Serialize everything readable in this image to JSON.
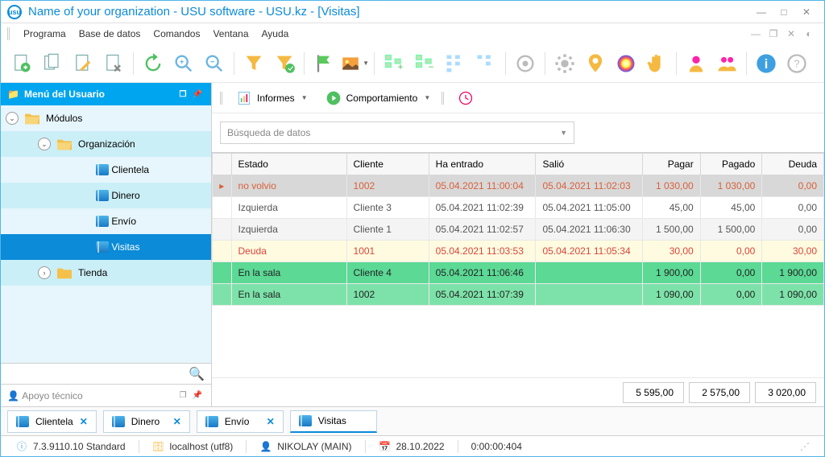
{
  "window": {
    "title": "Name of your organization - USU software - USU.kz - [Visitas]"
  },
  "menu": {
    "items": [
      "Programa",
      "Base de datos",
      "Comandos",
      "Ventana",
      "Ayuda"
    ]
  },
  "sidebar": {
    "title": "Menú del Usuario",
    "tree": {
      "modules": "Módulos",
      "organization": "Organización",
      "clientela": "Clientela",
      "dinero": "Dinero",
      "envio": "Envío",
      "visitas": "Visitas",
      "tienda": "Tienda"
    },
    "support": "Apoyo técnico"
  },
  "toolbar2": {
    "informes": "Informes",
    "comportamiento": "Comportamiento"
  },
  "search": {
    "placeholder": "Búsqueda de datos"
  },
  "grid": {
    "headers": {
      "estado": "Estado",
      "cliente": "Cliente",
      "entrado": "Ha entrado",
      "salio": "Salió",
      "pagar": "Pagar",
      "pagado": "Pagado",
      "deuda": "Deuda"
    },
    "rows": [
      {
        "estado": "no volvio",
        "cliente": "1002",
        "entrado": "05.04.2021 11:00:04",
        "salio": "05.04.2021 11:02:03",
        "pagar": "1 030,00",
        "pagado": "1 030,00",
        "deuda": "0,00"
      },
      {
        "estado": "Izquierda",
        "cliente": "Cliente 3",
        "entrado": "05.04.2021 11:02:39",
        "salio": "05.04.2021 11:05:00",
        "pagar": "45,00",
        "pagado": "45,00",
        "deuda": "0,00"
      },
      {
        "estado": "Izquierda",
        "cliente": "Cliente 1",
        "entrado": "05.04.2021 11:02:57",
        "salio": "05.04.2021 11:06:30",
        "pagar": "1 500,00",
        "pagado": "1 500,00",
        "deuda": "0,00"
      },
      {
        "estado": "Deuda",
        "cliente": "1001",
        "entrado": "05.04.2021 11:03:53",
        "salio": "05.04.2021 11:05:34",
        "pagar": "30,00",
        "pagado": "0,00",
        "deuda": "30,00"
      },
      {
        "estado": "En la sala",
        "cliente": "Cliente 4",
        "entrado": "05.04.2021 11:06:46",
        "salio": "",
        "pagar": "1 900,00",
        "pagado": "0,00",
        "deuda": "1 900,00"
      },
      {
        "estado": "En la sala",
        "cliente": "1002",
        "entrado": "05.04.2021 11:07:39",
        "salio": "",
        "pagar": "1 090,00",
        "pagado": "0,00",
        "deuda": "1 090,00"
      }
    ],
    "totals": {
      "pagar": "5 595,00",
      "pagado": "2 575,00",
      "deuda": "3 020,00"
    }
  },
  "tabs": [
    {
      "label": "Clientela"
    },
    {
      "label": "Dinero"
    },
    {
      "label": "Envío"
    },
    {
      "label": "Visitas"
    }
  ],
  "status": {
    "version": "7.3.9110.10 Standard",
    "host": "localhost (utf8)",
    "user": "NIKOLAY (MAIN)",
    "date": "28.10.2022",
    "time": "0:00:00:404"
  }
}
